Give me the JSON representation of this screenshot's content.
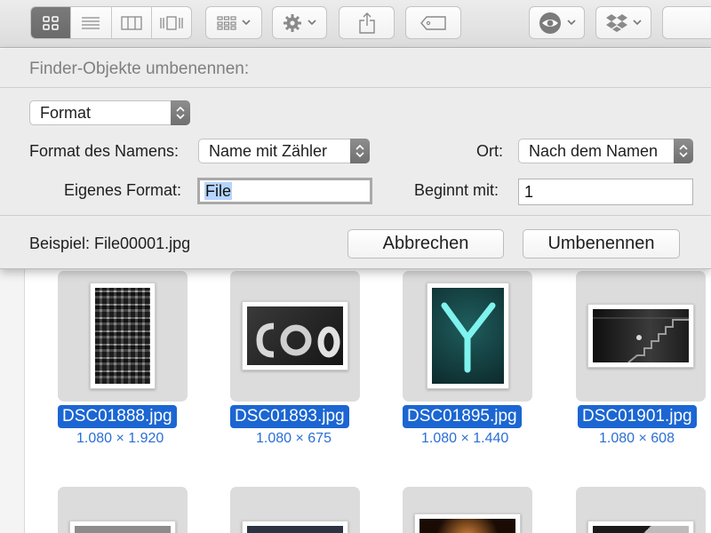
{
  "toolbar": {
    "view_buttons": [
      "icon-view",
      "list-view",
      "column-view",
      "cover-flow-view"
    ],
    "active_view": "icon-view"
  },
  "rename_panel": {
    "title": "Finder-Objekte umbenennen:",
    "mode_popup": "Format",
    "name_format_label": "Format des Namens:",
    "name_format_value": "Name mit Zähler",
    "location_label": "Ort:",
    "location_value": "Nach dem Namen",
    "custom_format_label": "Eigenes Format:",
    "custom_format_value": "File",
    "start_label": "Beginnt mit:",
    "start_value": "1",
    "example_text": "Beispiel: File00001.jpg",
    "cancel_label": "Abbrechen",
    "rename_label": "Umbenennen"
  },
  "files": [
    {
      "name": "DSC01888.jpg",
      "dims": "1.080 × 1.920"
    },
    {
      "name": "DSC01893.jpg",
      "dims": "1.080 × 675"
    },
    {
      "name": "DSC01895.jpg",
      "dims": "1.080 × 1.440"
    },
    {
      "name": "DSC01901.jpg",
      "dims": "1.080 × 608"
    }
  ],
  "colors": {
    "selection_blue": "#1b66d2",
    "dims_blue": "#2a6fd6",
    "panel_bg": "#ececec"
  }
}
